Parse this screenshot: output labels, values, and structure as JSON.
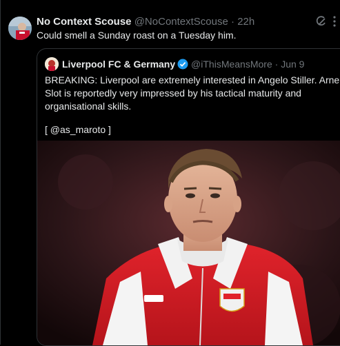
{
  "post": {
    "display_name": "No Context Scouse",
    "handle": "@NoContextScouse",
    "separator": "·",
    "time": "22h",
    "text": "Could smell a Sunday roast on a Tuesday him."
  },
  "quoted": {
    "display_name": "Liverpool FC & Germany",
    "handle": "@iThisMeansMore",
    "separator": "·",
    "time": "Jun 9",
    "text": "BREAKING: Liverpool are extremely interested in Angelo Stiller. Arne Slot is reportedly very impressed by his tactical maturity and organisational skills.",
    "source": "[ @as_maroto ]",
    "verified_color": "#1d9bf0"
  },
  "icons": {
    "post_avatar": "avatar-icon",
    "grok": "grok-icon",
    "more": "more-icon",
    "verified": "verified-badge-icon"
  }
}
